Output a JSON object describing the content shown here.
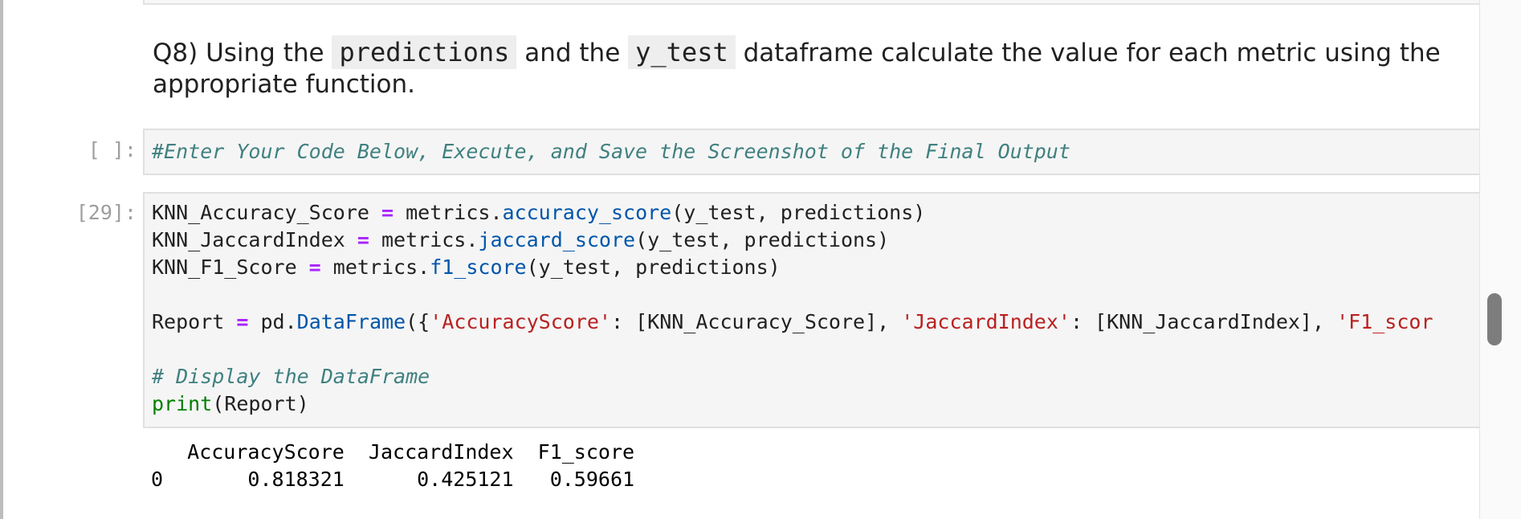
{
  "markdown": {
    "q_prefix": "Q8) Using the ",
    "code1": "predictions",
    "mid": " and the ",
    "code2": "y_test",
    "q_suffix": " dataframe calculate the value for each metric using the appropriate function."
  },
  "cell1": {
    "prompt": "[ ]:",
    "comment": "#Enter Your Code Below, Execute, and Save the Screenshot of the Final Output"
  },
  "cell2": {
    "prompt": "[29]:",
    "lines": {
      "l1_var": "KNN_Accuracy_Score ",
      "l1_eq": "=",
      "l1_obj": " metrics.",
      "l1_fn": "accuracy_score",
      "l1_args": "(y_test, predictions)",
      "l2_var": "KNN_JaccardIndex ",
      "l2_eq": "=",
      "l2_obj": " metrics.",
      "l2_fn": "jaccard_score",
      "l2_args": "(y_test, predictions)",
      "l3_var": "KNN_F1_Score ",
      "l3_eq": "=",
      "l3_obj": " metrics.",
      "l3_fn": "f1_score",
      "l3_args": "(y_test, predictions)",
      "l5_var": "Report ",
      "l5_eq": "=",
      "l5_obj": " pd.",
      "l5_fn": "DataFrame",
      "l5_p1": "({",
      "l5_s1": "'AccuracyScore'",
      "l5_p2": ": [KNN_Accuracy_Score], ",
      "l5_s2": "'JaccardIndex'",
      "l5_p3": ": [KNN_JaccardIndex], ",
      "l5_s3": "'F1_scor",
      "l7_comment": "# Display the DataFrame",
      "l8_fn": "print",
      "l8_args": "(Report)"
    }
  },
  "output": {
    "header": "   AccuracyScore  JaccardIndex  F1_score",
    "row0": "0       0.818321      0.425121   0.59661"
  }
}
